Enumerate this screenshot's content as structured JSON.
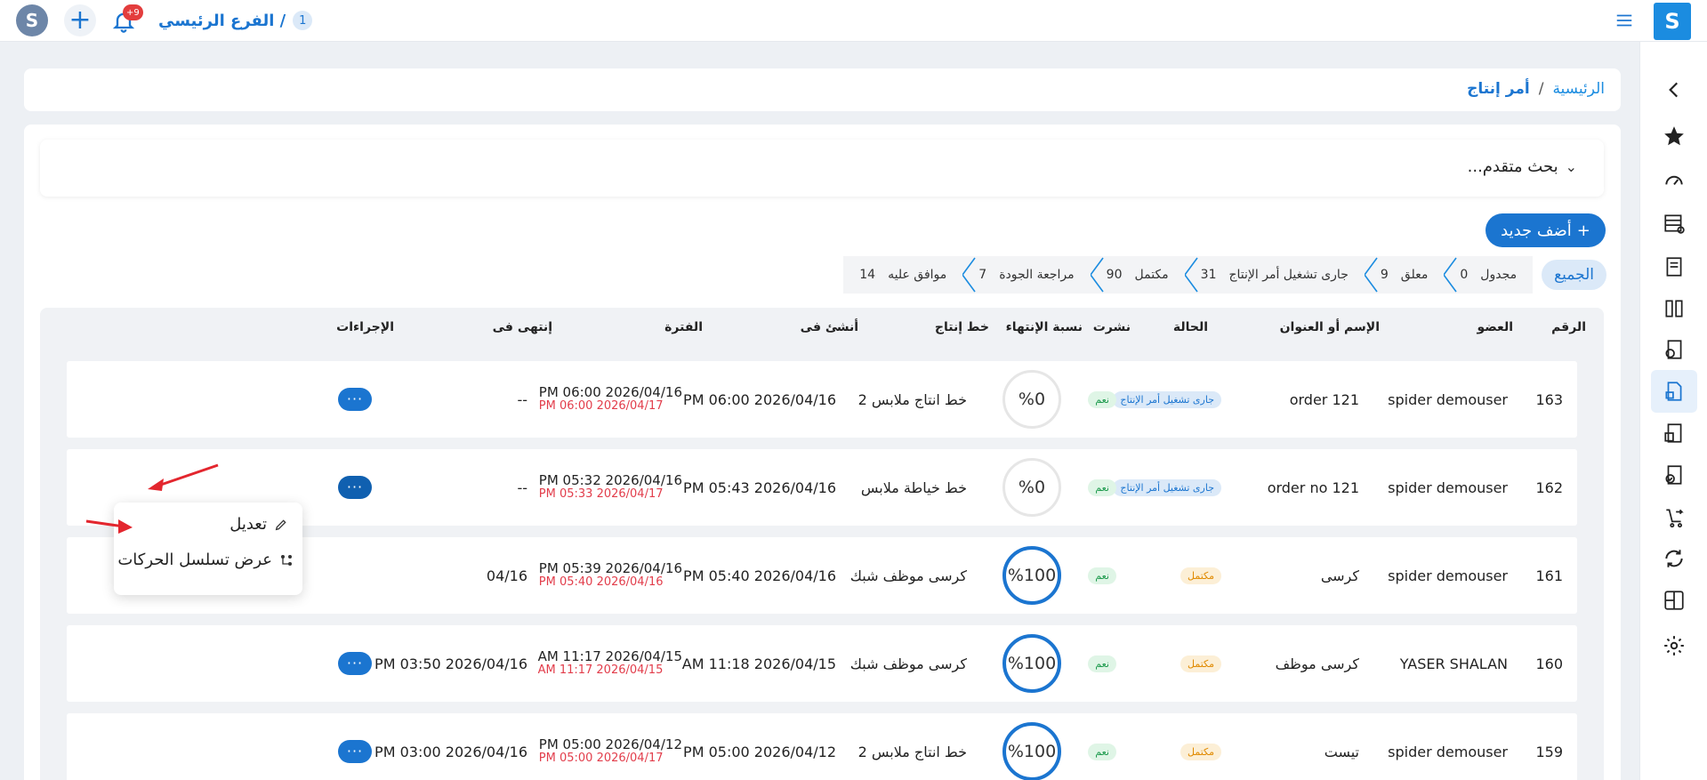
{
  "topbar": {
    "notification_badge": "+9",
    "branch_count": "1",
    "branch_name": "الفرع الرئيسي /"
  },
  "breadcrumb": {
    "home": "الرئيسية",
    "separator": "/",
    "current": "أمر إنتاج"
  },
  "search": {
    "toggle_label": "بحث متقدم..."
  },
  "add_button": {
    "label": "أضف جديد"
  },
  "filters": {
    "all": "الجميع",
    "items": [
      {
        "label": "مجدول",
        "count": "0"
      },
      {
        "label": "معلق",
        "count": "9"
      },
      {
        "label": "جارى تشغيل أمر الإنتاج",
        "count": "31"
      },
      {
        "label": "مكتمل",
        "count": "90"
      },
      {
        "label": "مراجعة الجودة",
        "count": "7"
      },
      {
        "label": "موافق عليه",
        "count": "14"
      }
    ]
  },
  "table": {
    "headers": {
      "number": "الرقم",
      "member": "العضو",
      "name": "الإسم أو العنوان",
      "status": "الحالة",
      "published": "نشرت",
      "progress": "نسبة الإنتهاء",
      "line": "خط إنتاج",
      "created": "أنشئ فى",
      "period": "الفترة",
      "ended": "إنتهى فى",
      "actions": "الإجراءات"
    },
    "rows": [
      {
        "number": "163",
        "member": "spider demouser",
        "name": "order 121",
        "status": "جارى تشغيل أمر الإنتاج",
        "status_kind": "running",
        "published": "نعم",
        "progress": "%0",
        "progress_value": 0,
        "line": "خط انتاج ملابس 2",
        "created": "PM 06:00 2026/04/16",
        "period_start": "PM 06:00 2026/04/16",
        "period_end": "PM 06:00 2026/04/17",
        "ended": "--"
      },
      {
        "number": "162",
        "member": "spider demouser",
        "name": "order no 121",
        "status": "جارى تشغيل أمر الإنتاج",
        "status_kind": "running",
        "published": "نعم",
        "progress": "%0",
        "progress_value": 0,
        "line": "خط خياطة ملابس",
        "created": "PM 05:43 2026/04/16",
        "period_start": "PM 05:32 2026/04/16",
        "period_end": "PM 05:33 2026/04/17",
        "ended": "--"
      },
      {
        "number": "161",
        "member": "spider demouser",
        "name": "كرسى",
        "status": "مكتمل",
        "status_kind": "done",
        "published": "نعم",
        "progress": "%100",
        "progress_value": 100,
        "line": "كرسى موظف شبك",
        "created": "PM 05:40 2026/04/16",
        "period_start": "PM 05:39 2026/04/16",
        "period_end": "PM 05:40 2026/04/16",
        "ended": "04/16"
      },
      {
        "number": "160",
        "member": "YASER SHALAN",
        "name": "كرسى موظف",
        "status": "مكتمل",
        "status_kind": "done",
        "published": "نعم",
        "progress": "%100",
        "progress_value": 100,
        "line": "كرسى موظف شبك",
        "created": "AM 11:18 2026/04/15",
        "period_start": "AM 11:17 2026/04/15",
        "period_end": "AM 11:17 2026/04/15",
        "ended": "PM 03:50 2026/04/16"
      },
      {
        "number": "159",
        "member": "spider demouser",
        "name": "تيست",
        "status": "مكتمل",
        "status_kind": "done",
        "published": "نعم",
        "progress": "%100",
        "progress_value": 100,
        "line": "خط انتاج ملابس 2",
        "created": "PM 05:00 2026/04/12",
        "period_start": "PM 05:00 2026/04/12",
        "period_end": "PM 05:00 2026/04/17",
        "ended": "PM 03:00 2026/04/16"
      }
    ],
    "action_label": "···"
  },
  "action_menu": {
    "edit": "تعديل",
    "view_sequence": "عرض تسلسل الحركات"
  },
  "colors": {
    "primary": "#1b75d0",
    "danger": "#e23d4b",
    "success": "#1c9a4c",
    "warning": "#e08a00"
  }
}
